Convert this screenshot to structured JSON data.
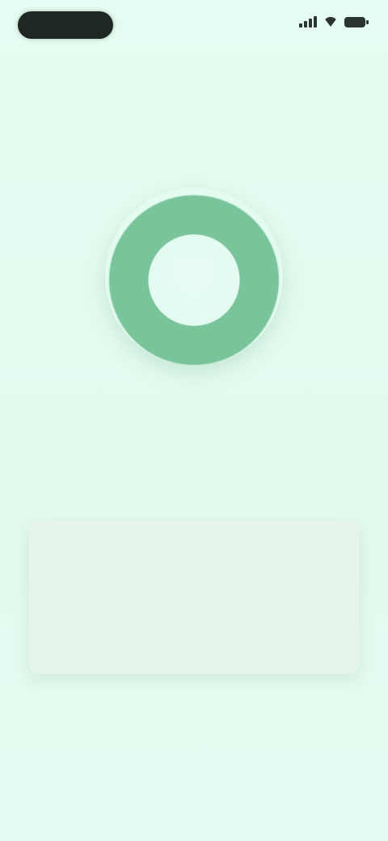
{
  "status_bar": {
    "time": "",
    "icons": [
      "signal-icon",
      "wifi-icon",
      "battery-icon"
    ]
  },
  "header": {
    "title": ""
  },
  "ring": {
    "icon": "heart-icon",
    "caption": ""
  },
  "card": {
    "label": "",
    "text": ""
  },
  "colors": {
    "background": "#e3fbf0",
    "ring": "#79c49b",
    "card": "#e6f4ec",
    "pill": "#1f2723"
  }
}
